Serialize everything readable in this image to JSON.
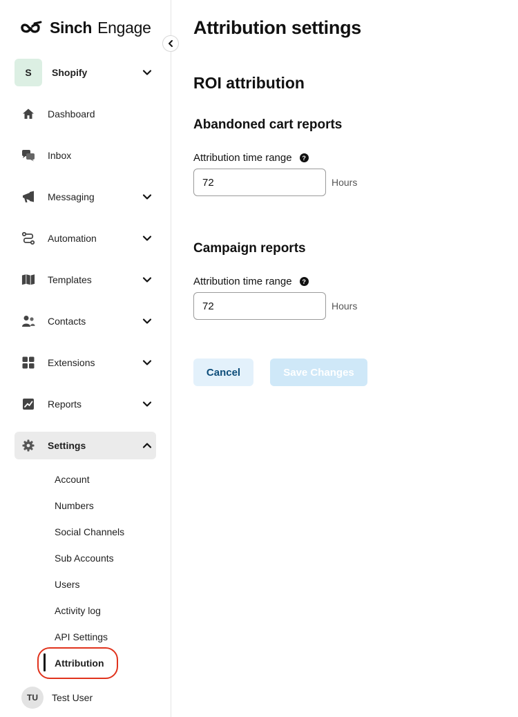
{
  "brand": {
    "name_bold": "Sinch",
    "name": "Engage"
  },
  "account": {
    "initial": "S",
    "name": "Shopify"
  },
  "nav": [
    {
      "label": "Dashboard",
      "icon": "home-icon",
      "has_chevron": false
    },
    {
      "label": "Inbox",
      "icon": "chat-icon",
      "has_chevron": false
    },
    {
      "label": "Messaging",
      "icon": "megaphone-icon",
      "has_chevron": true
    },
    {
      "label": "Automation",
      "icon": "flow-icon",
      "has_chevron": true
    },
    {
      "label": "Templates",
      "icon": "book-icon",
      "has_chevron": true
    },
    {
      "label": "Contacts",
      "icon": "people-icon",
      "has_chevron": true
    },
    {
      "label": "Extensions",
      "icon": "grid-icon",
      "has_chevron": true
    },
    {
      "label": "Reports",
      "icon": "chart-icon",
      "has_chevron": true
    },
    {
      "label": "Settings",
      "icon": "gear-icon",
      "has_chevron": true,
      "expanded": true,
      "active": true
    }
  ],
  "settings_sub": [
    "Account",
    "Numbers",
    "Social Channels",
    "Sub Accounts",
    "Users",
    "Activity log",
    "API Settings",
    "Attribution"
  ],
  "active_sub": "Attribution",
  "user": {
    "initials": "TU",
    "name": "Test User"
  },
  "page": {
    "title": "Attribution settings",
    "section": "ROI attribution",
    "abandoned": {
      "heading": "Abandoned cart reports",
      "label": "Attribution time range",
      "value": "72",
      "unit": "Hours"
    },
    "campaign": {
      "heading": "Campaign reports",
      "label": "Attribution time range",
      "value": "72",
      "unit": "Hours"
    },
    "cancel_label": "Cancel",
    "save_label": "Save Changes"
  },
  "colors": {
    "accent_ring": "#e0321c",
    "cancel_text": "#0d4d7a",
    "save_bg": "#cfe8f8",
    "active_nav_bg": "#ebebeb"
  }
}
